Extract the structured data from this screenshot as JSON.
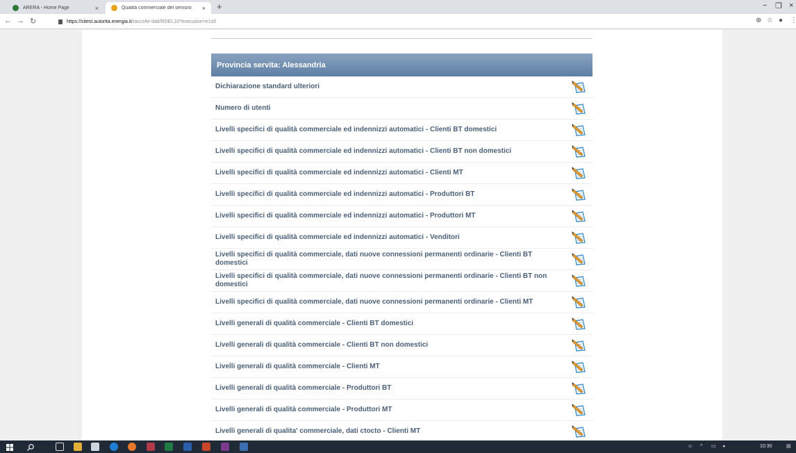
{
  "browser": {
    "tabs": [
      {
        "title": "ARERA - Home Page"
      },
      {
        "title": "Qualità commerciale del servizio"
      }
    ],
    "new_tab": "+",
    "close_glyph": "×",
    "url_host": "https://sitest.autorita.energia.it",
    "url_path": "/raccolte-dati/RDEL10?execution=e1s5"
  },
  "table": {
    "header": "Provincia servita: Alessandria",
    "rows": [
      "Dichiarazione standard ulteriori",
      "Numero di utenti",
      "Livelli specifici di qualità commerciale ed indennizzi automatici - Clienti BT domestici",
      "Livelli specifici di qualità commerciale ed indennizzi automatici - Clienti BT non domestici",
      "Livelli specifici di qualità commerciale ed indennizzi automatici - Clienti MT",
      "Livelli specifici di qualità commerciale ed indennizzi automatici - Produttori BT",
      "Livelli specifici di qualità commerciale ed indennizzi automatici - Produttori MT",
      "Livelli specifici di qualità commerciale ed indennizzi automatici - Venditori",
      "Livelli specifici di qualità commerciale, dati nuove connessioni permanenti ordinarie - Clienti BT domestici",
      "Livelli specifici di qualità commerciale, dati nuove connessioni permanenti ordinarie - Clienti BT non domestici",
      "Livelli specifici di qualità commerciale, dati nuove connessioni permanenti ordinarie - Clienti MT",
      "Livelli generali di qualità commerciale - Clienti BT domestici",
      "Livelli generali di qualità commerciale - Clienti BT non domestici",
      "Livelli generali di qualità commerciale - Clienti MT",
      "Livelli generali di qualità commerciale - Produttori BT",
      "Livelli generali di qualità commerciale - Produttori MT",
      "Livelli generali di qualita' commerciale, dati ctocto - Clienti MT"
    ]
  },
  "taskbar": {
    "time": "10:30"
  },
  "colors": {
    "header_top": "#8aa3c0",
    "header_bottom": "#5e7fa5",
    "link_text": "#4a5f78",
    "taskbar": "#1f2a36"
  }
}
